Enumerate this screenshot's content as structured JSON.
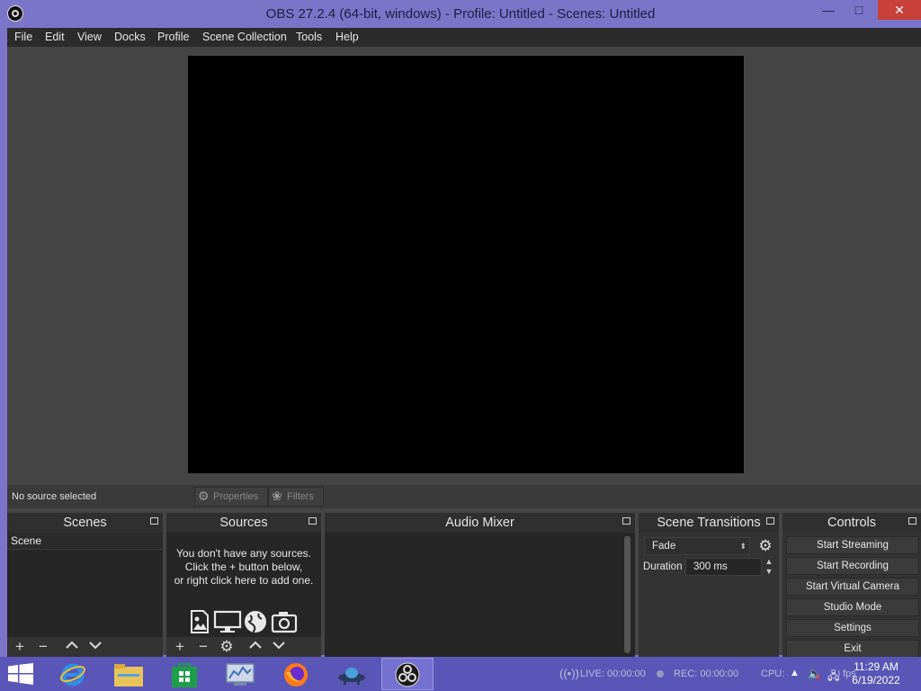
{
  "window": {
    "title": "OBS 27.2.4 (64-bit, windows) - Profile: Untitled - Scenes: Untitled",
    "minimize": "—",
    "maximize": "□",
    "close": "✕"
  },
  "menu": {
    "items": [
      "File",
      "Edit",
      "View",
      "Docks",
      "Profile",
      "Scene Collection",
      "Tools",
      "Help"
    ]
  },
  "source_toolbar": {
    "status": "No source selected",
    "properties": "Properties",
    "filters": "Filters"
  },
  "docks": {
    "scenes": {
      "title": "Scenes",
      "items": [
        "Scene"
      ]
    },
    "sources": {
      "title": "Sources",
      "empty_line1": "You don't have any sources.",
      "empty_line2": "Click the + button below,",
      "empty_line3": "or right click here to add one."
    },
    "audio_mixer": {
      "title": "Audio Mixer"
    },
    "transitions": {
      "title": "Scene Transitions",
      "selected": "Fade",
      "duration_label": "Duration",
      "duration_value": "300 ms"
    },
    "controls": {
      "title": "Controls",
      "buttons": [
        "Start Streaming",
        "Start Recording",
        "Start Virtual Camera",
        "Studio Mode",
        "Settings",
        "Exit"
      ]
    }
  },
  "status": {
    "live": "LIVE: 00:00:00",
    "rec": "REC: 00:00:00",
    "cpu": "CPU: 4.7%, 30.00 fps"
  },
  "clock": {
    "time": "11:29 AM",
    "date": "6/19/2022"
  },
  "colors": {
    "accent": "#7b75c9",
    "taskbar": "#5956b7",
    "panel": "#333333",
    "preview": "#000000"
  }
}
